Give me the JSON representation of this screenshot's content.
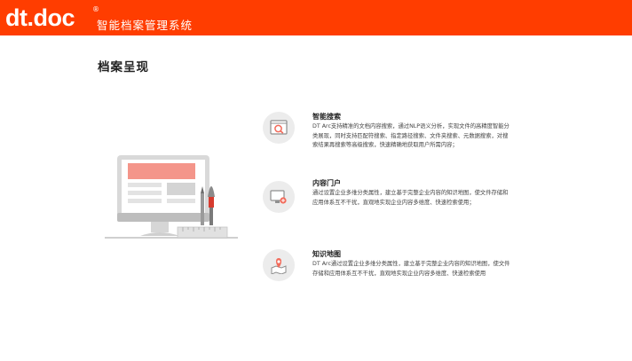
{
  "header": {
    "logo": "dt.doc",
    "registered_mark": "®",
    "subtitle": "智能档案管理系统"
  },
  "page": {
    "title": "档案呈现"
  },
  "features": [
    {
      "title": "智能搜索",
      "description": "DT Arc支持精准的文档内容搜索，通过NLP语义分析，实现文件的高精度智能分类展现，同时支持匹配符搜索、指定路径搜索、文件夹搜索、元数据搜索，对搜索结果再搜索等高级搜索，快速精确地获取用户所需内容；",
      "icon": "search-icon"
    },
    {
      "title": "内容门户",
      "description": "通过设置企业多维分类属性，建立基于完整企业内容的知识地图，使文件存储和应用体系互不干扰，直观地实现企业内容多维度、快速检索使用；",
      "icon": "portal-icon"
    },
    {
      "title": "知识地图",
      "description": "DT Arc通过设置企业多维分类属性，建立基于完整企业内容的知识地图，使文件存储和应用体系互不干扰，直观地实现企业内容多维度、快速检索使用",
      "icon": "map-pin-icon"
    }
  ],
  "colors": {
    "brand": "#ff3d00",
    "accent": "#f26b5b",
    "icon_bg": "#ececec"
  }
}
